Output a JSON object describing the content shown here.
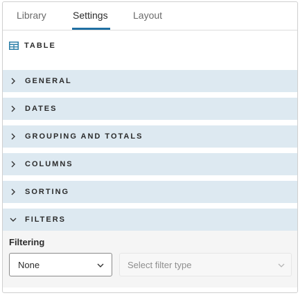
{
  "tabs": [
    {
      "label": "Library",
      "active": false
    },
    {
      "label": "Settings",
      "active": true
    },
    {
      "label": "Layout",
      "active": false
    }
  ],
  "section": {
    "icon": "table-icon",
    "title": "TABLE"
  },
  "accordion": [
    {
      "label": "GENERAL",
      "expanded": false
    },
    {
      "label": "DATES",
      "expanded": false
    },
    {
      "label": "GROUPING AND TOTALS",
      "expanded": false
    },
    {
      "label": "COLUMNS",
      "expanded": false
    },
    {
      "label": "SORTING",
      "expanded": false
    },
    {
      "label": "FILTERS",
      "expanded": true
    }
  ],
  "filters": {
    "label": "Filtering",
    "selected": "None",
    "type_placeholder": "Select filter type"
  },
  "colors": {
    "accent": "#1f6fa3",
    "row_bg": "#dde9f1",
    "icon_teal": "#2c7fa8"
  }
}
